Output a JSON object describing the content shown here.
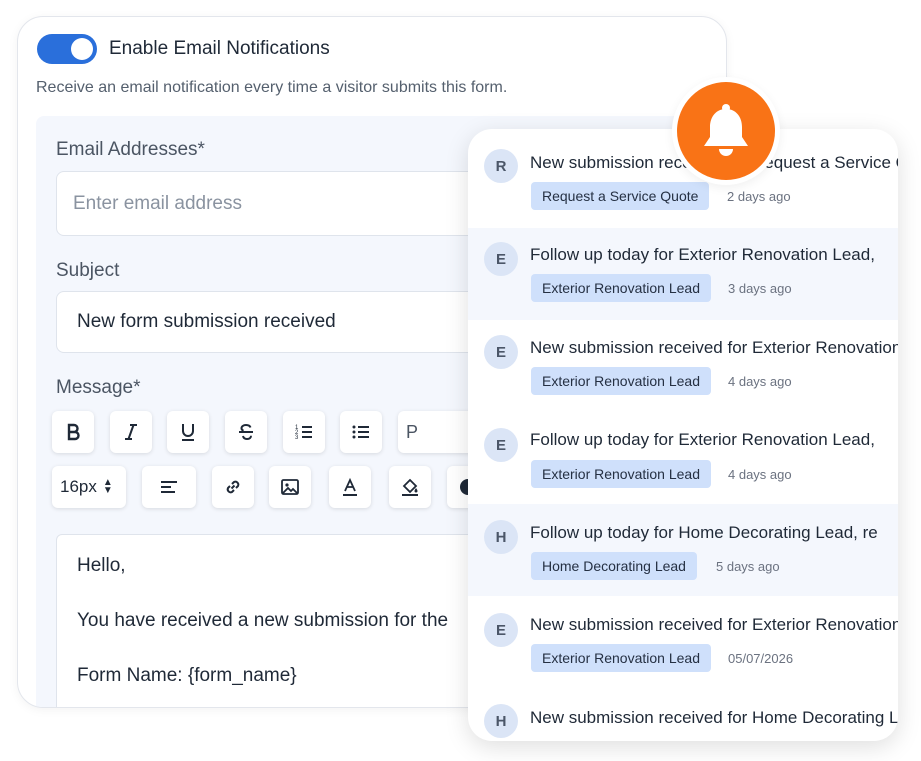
{
  "notifications_settings": {
    "toggle_label": "Enable Email Notifications",
    "toggle_on": true,
    "description": "Receive an email notification every time a visitor submits this form.",
    "email": {
      "label": "Email Addresses*",
      "placeholder": "Enter email address"
    },
    "subject": {
      "label": "Subject",
      "value": "New form submission received"
    },
    "message": {
      "label": "Message*",
      "paragraph_format": "P",
      "font_size": "16px",
      "body_lines": [
        "Hello,",
        "You have received a new submission for the",
        "Form Name: {form_name}"
      ]
    }
  },
  "colors": {
    "toggle": "#2a6fdb",
    "bell": "#f97316",
    "tag": "#cfe0fb"
  },
  "notifications": [
    {
      "initial": "R",
      "title": "New submission received for Request a Service Quote",
      "tag": "Request a Service Quote",
      "time": "2 days ago"
    },
    {
      "initial": "E",
      "title": "Follow up today for Exterior Renovation Lead, ",
      "tag": "Exterior Renovation Lead",
      "time": "3 days ago"
    },
    {
      "initial": "E",
      "title": "New submission received for Exterior Renovation Lead",
      "tag": "Exterior Renovation Lead",
      "time": "4 days ago"
    },
    {
      "initial": "E",
      "title": "Follow up today for Exterior Renovation Lead, ",
      "tag": "Exterior Renovation Lead",
      "time": "4 days ago"
    },
    {
      "initial": "H",
      "title": "Follow up today for Home Decorating Lead, re",
      "tag": "Home Decorating Lead",
      "time": "5 days ago"
    },
    {
      "initial": "E",
      "title": "New submission received for Exterior Renovation Lead",
      "tag": "Exterior Renovation Lead",
      "time": "05/07/2026"
    },
    {
      "initial": "H",
      "title": "New submission received for Home Decorating Lead",
      "tag": "",
      "time": ""
    }
  ]
}
